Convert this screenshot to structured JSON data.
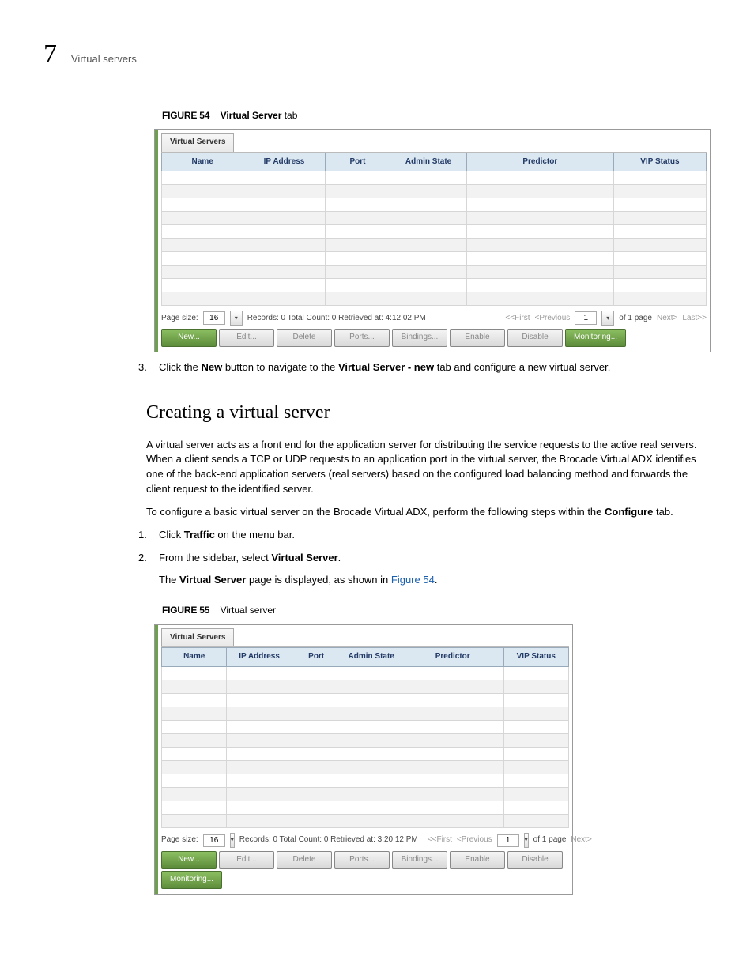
{
  "header": {
    "chapter_number": "7",
    "chapter_title": "Virtual servers"
  },
  "figure54": {
    "label": "FIGURE 54",
    "caption_prefix": "Virtual Server",
    "caption_suffix": " tab",
    "tab_title": "Virtual Servers",
    "columns": [
      "Name",
      "IP Address",
      "Port",
      "Admin State",
      "Predictor",
      "VIP Status"
    ],
    "page_size_label": "Page size:",
    "page_size_value": "16",
    "records_text": "Records: 0  Total Count: 0   Retrieved at: 4:12:02 PM",
    "nav_first": "<<First",
    "nav_prev": "<Previous",
    "page_current": "1",
    "of_pages": "of 1 page",
    "nav_next": "Next>",
    "nav_last": "Last>>",
    "buttons": {
      "new": "New...",
      "edit": "Edit...",
      "delete": "Delete",
      "ports": "Ports...",
      "bindings": "Bindings...",
      "enable": "Enable",
      "disable": "Disable",
      "monitoring": "Monitoring..."
    }
  },
  "step3": {
    "num": "3.",
    "t1": "Click the ",
    "b1": "New",
    "t2": " button to navigate to the ",
    "b2": "Virtual Server - new",
    "t3": " tab and configure a new virtual server."
  },
  "section": {
    "heading": "Creating a virtual server",
    "para1": "A virtual server acts as a front end for the application server for distributing the service requests to the active real servers. When a client sends a TCP or UDP requests to an application port in the virtual server, the Brocade Virtual ADX identifies one of the back-end application servers (real servers) based on the configured load balancing method and forwards the client request to the identified server.",
    "para2_t1": "To configure a basic virtual server on the Brocade Virtual ADX, perform the following steps within the ",
    "para2_b1": "Configure",
    "para2_t2": " tab.",
    "step1_num": "1.",
    "step1_t1": "Click ",
    "step1_b1": "Traffic",
    "step1_t2": " on the menu bar.",
    "step2_num": "2.",
    "step2_t1": "From the sidebar, select ",
    "step2_b1": "Virtual Server",
    "step2_t2": ".",
    "step2_sub_t1": "The ",
    "step2_sub_b1": "Virtual Server",
    "step2_sub_t2": " page is displayed, as shown in ",
    "step2_sub_link": "Figure 54",
    "step2_sub_t3": "."
  },
  "figure55": {
    "label": "FIGURE 55",
    "caption": "Virtual server",
    "tab_title": "Virtual Servers",
    "columns": [
      "Name",
      "IP Address",
      "Port",
      "Admin State",
      "Predictor",
      "VIP Status"
    ],
    "page_size_label": "Page size:",
    "page_size_value": "16",
    "records_text": "Records: 0  Total Count: 0   Retrieved at: 3:20:12 PM",
    "nav_first": "<<First",
    "nav_prev": "<Previous",
    "page_current": "1",
    "of_pages": "of 1 page",
    "nav_next": "Next>",
    "buttons": {
      "new": "New...",
      "edit": "Edit...",
      "delete": "Delete",
      "ports": "Ports...",
      "bindings": "Bindings...",
      "enable": "Enable",
      "disable": "Disable",
      "monitoring": "Monitoring..."
    }
  }
}
